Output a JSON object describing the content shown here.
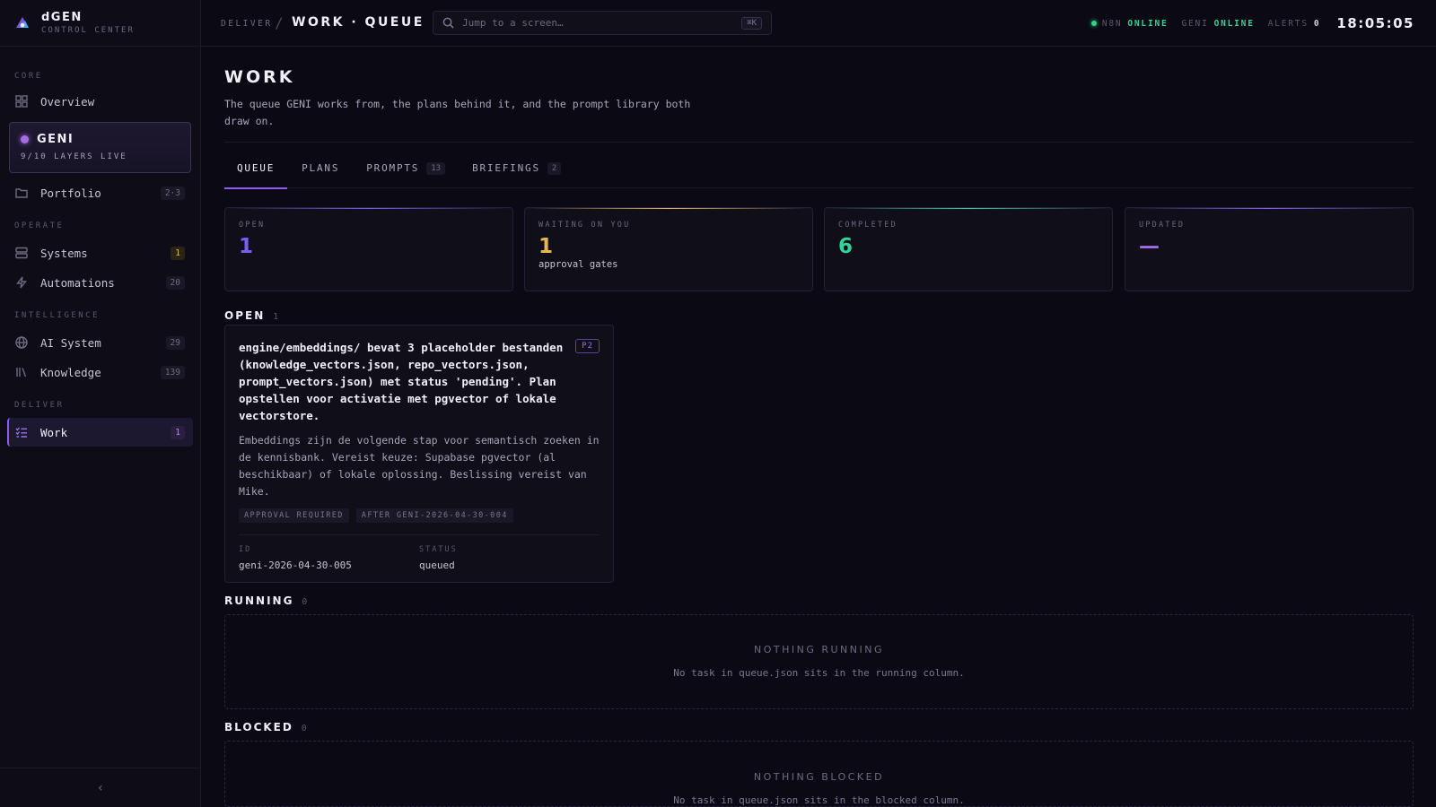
{
  "brand": {
    "name": "dGEN",
    "subtitle": "CONTROL CENTER"
  },
  "sidebar": {
    "sections": {
      "core": "CORE",
      "operate": "OPERATE",
      "intelligence": "INTELLIGENCE",
      "deliver": "DELIVER"
    },
    "overview": {
      "label": "Overview"
    },
    "geni": {
      "title": "GENI",
      "subtitle": "9/10 LAYERS LIVE"
    },
    "portfolio": {
      "label": "Portfolio",
      "badge": "2·3"
    },
    "systems": {
      "label": "Systems",
      "badge": "1"
    },
    "automations": {
      "label": "Automations",
      "badge": "20"
    },
    "ai_system": {
      "label": "AI System",
      "badge": "29"
    },
    "knowledge": {
      "label": "Knowledge",
      "badge": "139"
    },
    "work": {
      "label": "Work",
      "badge": "1"
    },
    "collapse_icon": "‹"
  },
  "topbar": {
    "crumb_root": "DELIVER",
    "crumb_sep": "/",
    "crumb_page": "WORK · QUEUE",
    "search_placeholder": "Jump to a screen…",
    "search_kbd": "⌘K",
    "n8n_key": "N8N",
    "n8n_val": "ONLINE",
    "geni_key": "GENI",
    "geni_val": "ONLINE",
    "alerts_key": "ALERTS",
    "alerts_val": "0",
    "clock": "18:05:05"
  },
  "page": {
    "title": "WORK",
    "description": "The queue GENI works from, the plans behind it, and the prompt library both draw on."
  },
  "tabs": [
    {
      "label": "QUEUE",
      "count": ""
    },
    {
      "label": "PLANS",
      "count": ""
    },
    {
      "label": "PROMPTS",
      "count": "13"
    },
    {
      "label": "BRIEFINGS",
      "count": "2"
    }
  ],
  "stats": {
    "open": {
      "label": "OPEN",
      "value": "1",
      "note": ""
    },
    "waiting": {
      "label": "WAITING ON YOU",
      "value": "1",
      "note": "approval gates"
    },
    "completed": {
      "label": "COMPLETED",
      "value": "6",
      "note": ""
    },
    "updated": {
      "label": "UPDATED",
      "value": "—",
      "note": ""
    }
  },
  "colors": {
    "accent": "#8b5cf6",
    "open": "#7c5cf6",
    "waiting": "#e6b84c",
    "completed": "#34d399",
    "online": "#34d399"
  },
  "sections": {
    "open": {
      "title": "OPEN",
      "count": "1"
    },
    "running": {
      "title": "RUNNING",
      "count": "0",
      "empty_title": "NOTHING RUNNING",
      "empty_sub": "No task in queue.json sits in the running column."
    },
    "blocked": {
      "title": "BLOCKED",
      "count": "0",
      "empty_title": "NOTHING BLOCKED",
      "empty_sub": "No task in queue.json sits in the blocked column."
    }
  },
  "task": {
    "title": "engine/embeddings/ bevat 3 placeholder bestanden (knowledge_vectors.json, repo_vectors.json, prompt_vectors.json) met status 'pending'. Plan opstellen voor activatie met pgvector of lokale vectorstore.",
    "priority": "P2",
    "description": "Embeddings zijn de volgende stap voor semantisch zoeken in de kennisbank. Vereist keuze: Supabase pgvector (al beschikbaar) of lokale oplossing. Beslissing vereist van Mike.",
    "tags": [
      "APPROVAL REQUIRED",
      "AFTER GENI-2026-04-30-004"
    ],
    "id_label": "ID",
    "id_value": "geni-2026-04-30-005",
    "status_label": "STATUS",
    "status_value": "queued"
  }
}
